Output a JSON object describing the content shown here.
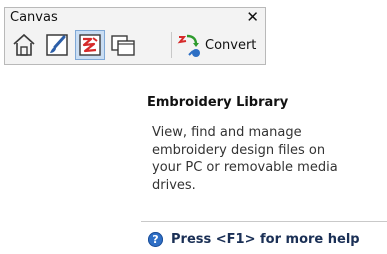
{
  "toolbar": {
    "title": "Canvas",
    "close_label": "✕",
    "buttons": [
      {
        "icon": "home-icon",
        "active": false
      },
      {
        "icon": "brush-canvas-icon",
        "active": false
      },
      {
        "icon": "embroidery-library-icon",
        "active": true
      },
      {
        "icon": "overlapping-windows-icon",
        "active": false
      }
    ],
    "convert_label": "Convert",
    "convert_icon": "convert-icon"
  },
  "tooltip": {
    "title": "Embroidery Library",
    "body": "View, find and manage\nembroidery design files on\nyour PC or removable media\ndrives.",
    "help_icon": "help-question-icon",
    "help_text": "Press <F1> for more help"
  },
  "colors": {
    "active_button_bg": "#c9ddf3",
    "help_icon": "#2f6fc6"
  }
}
